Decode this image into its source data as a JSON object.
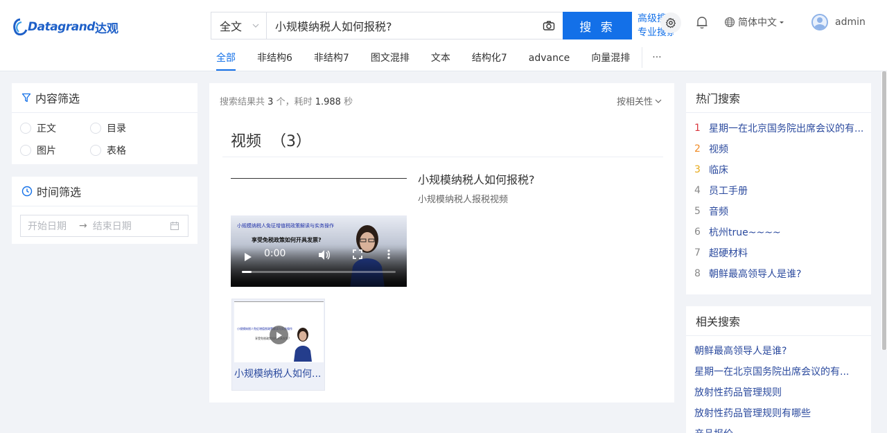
{
  "brand": {
    "logo_text": "Datagrand",
    "logo_cn": "达观"
  },
  "search": {
    "scope": "全文",
    "query": "小规模纳税人如何报税?",
    "button": "搜 索"
  },
  "header_links": {
    "advanced": "高级搜索",
    "professional": "专业搜索"
  },
  "language": "简体中文",
  "user": {
    "name": "admin"
  },
  "tabs": [
    "全部",
    "非结构6",
    "非结构7",
    "图文混排",
    "文本",
    "结构化7",
    "advance",
    "向量混排"
  ],
  "more_label": "···",
  "content_filter": {
    "title": "内容筛选",
    "options": [
      "正文",
      "目录",
      "图片",
      "表格"
    ]
  },
  "time_filter": {
    "title": "时间筛选",
    "start_placeholder": "开始日期",
    "end_placeholder": "结束日期",
    "separator": "→"
  },
  "results": {
    "info_prefix": "搜索结果共",
    "count": "3",
    "info_mid": "个，耗时",
    "time": "1.988",
    "info_suffix": "秒",
    "sort_label": "按相关性",
    "section_title": "视频  （3）",
    "item": {
      "title": "小规模纳税人如何报税?",
      "description": "小规模纳税人报税视频"
    },
    "player": {
      "time": "0:00",
      "slide_heading": "小规模纳税人免征增值税政策解读与实务操作",
      "slide_question": "享受免税政策如何开具发票?"
    },
    "thumbnail_caption": "小规模纳税人如何..."
  },
  "hot_search": {
    "title": "热门搜索",
    "items": [
      {
        "rank": "1",
        "text": "星期一在北京国务院出席会议的有...",
        "color": "#d9363e"
      },
      {
        "rank": "2",
        "text": "视频",
        "color": "#f08a24"
      },
      {
        "rank": "3",
        "text": "临床",
        "color": "#e6a817"
      },
      {
        "rank": "4",
        "text": "员工手册",
        "color": "#888888"
      },
      {
        "rank": "5",
        "text": "音频",
        "color": "#888888"
      },
      {
        "rank": "6",
        "text": "杭州true~~~~",
        "color": "#888888"
      },
      {
        "rank": "7",
        "text": "超硬材料",
        "color": "#888888"
      },
      {
        "rank": "8",
        "text": "朝鲜最高领导人是谁?",
        "color": "#888888"
      }
    ]
  },
  "related_search": {
    "title": "相关搜索",
    "items": [
      "朝鲜最高领导人是谁?",
      "星期一在北京国务院出席会议的有...",
      "放射性药品管理规则",
      "放射性药品管理规则有哪些",
      "产品报价"
    ]
  },
  "colors": {
    "primary": "#1370e8",
    "link": "#2b4a9e"
  }
}
